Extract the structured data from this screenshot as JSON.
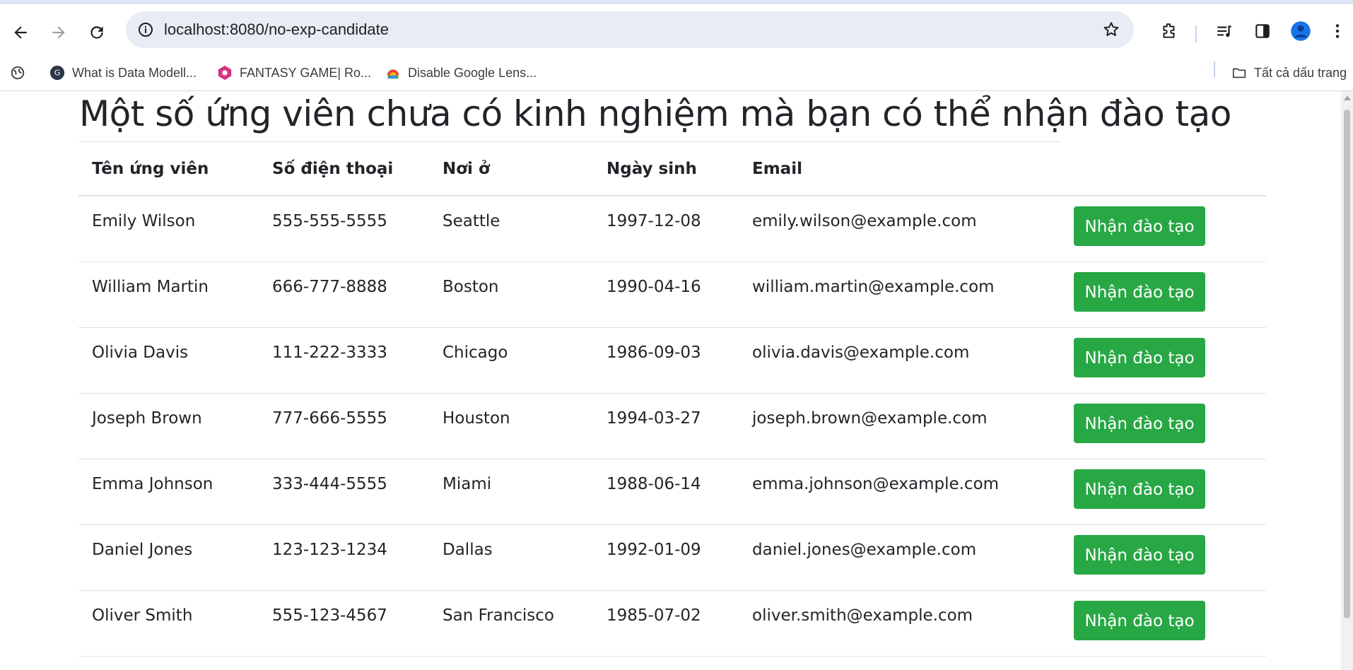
{
  "browser": {
    "url": "localhost:8080/no-exp-candidate",
    "bookmarks": [
      {
        "label": "What is Data Modell...",
        "icon": "site-icon-g"
      },
      {
        "label": "FANTASY GAME| Ro...",
        "icon": "site-icon-fantasy"
      },
      {
        "label": "Disable Google Lens...",
        "icon": "site-icon-colorful"
      }
    ],
    "all_bookmarks_label": "Tất cả dấu trang"
  },
  "page": {
    "title": "Một số ứng viên chưa có kinh nghiệm mà bạn có thể nhận đào tạo",
    "columns": [
      "Tên ứng viên",
      "Số điện thoại",
      "Nơi ở",
      "Ngày sinh",
      "Email"
    ],
    "action_label": "Nhận đào tạo",
    "accent_color": "#28a745",
    "rows": [
      {
        "name": "Emily Wilson",
        "phone": "555-555-5555",
        "city": "Seattle",
        "dob": "1997-12-08",
        "email": "emily.wilson@example.com"
      },
      {
        "name": "William Martin",
        "phone": "666-777-8888",
        "city": "Boston",
        "dob": "1990-04-16",
        "email": "william.martin@example.com"
      },
      {
        "name": "Olivia Davis",
        "phone": "111-222-3333",
        "city": "Chicago",
        "dob": "1986-09-03",
        "email": "olivia.davis@example.com"
      },
      {
        "name": "Joseph Brown",
        "phone": "777-666-5555",
        "city": "Houston",
        "dob": "1994-03-27",
        "email": "joseph.brown@example.com"
      },
      {
        "name": "Emma Johnson",
        "phone": "333-444-5555",
        "city": "Miami",
        "dob": "1988-06-14",
        "email": "emma.johnson@example.com"
      },
      {
        "name": "Daniel Jones",
        "phone": "123-123-1234",
        "city": "Dallas",
        "dob": "1992-01-09",
        "email": "daniel.jones@example.com"
      },
      {
        "name": "Oliver Smith",
        "phone": "555-123-4567",
        "city": "San Francisco",
        "dob": "1985-07-02",
        "email": "oliver.smith@example.com"
      }
    ]
  }
}
